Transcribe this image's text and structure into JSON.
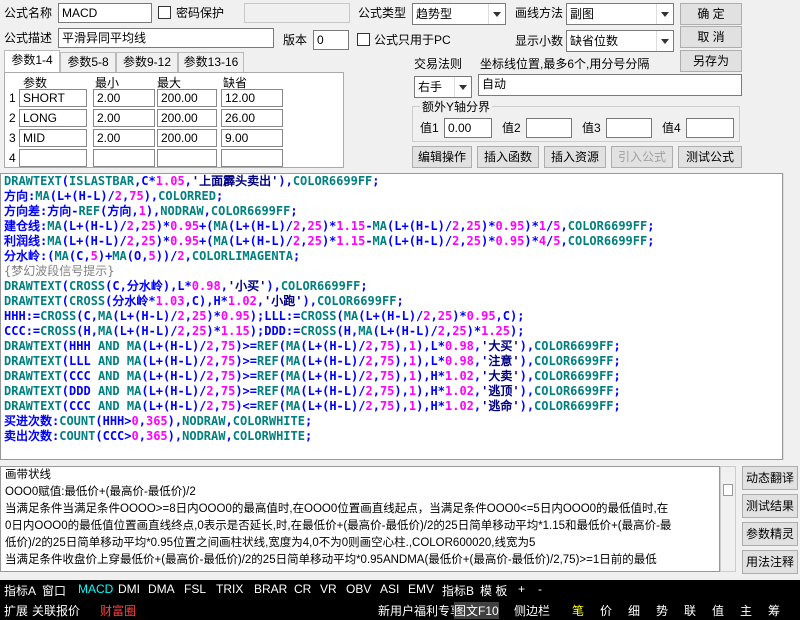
{
  "form": {
    "name_label": "公式名称",
    "name_value": "MACD",
    "pwd_label": "密码保护",
    "type_label": "公式类型",
    "type_value": "趋势型",
    "draw_label": "画线方法",
    "draw_value": "副图",
    "ok": "确  定",
    "cancel": "取  消",
    "saveas": "另存为",
    "desc_label": "公式描述",
    "desc_value": "平滑异同平均线",
    "ver_label": "版本",
    "ver_value": "0",
    "pc_label": "公式只用于PC",
    "dec_label": "显示小数",
    "dec_value": "缺省位数"
  },
  "tabs": [
    "参数1-4",
    "参数5-8",
    "参数9-12",
    "参数13-16"
  ],
  "params": {
    "headers": [
      "参数",
      "最小",
      "最大",
      "缺省"
    ],
    "rows": [
      {
        "n": "1",
        "name": "SHORT",
        "min": "2.00",
        "max": "200.00",
        "def": "12.00"
      },
      {
        "n": "2",
        "name": "LONG",
        "min": "2.00",
        "max": "200.00",
        "def": "26.00"
      },
      {
        "n": "3",
        "name": "MID",
        "min": "2.00",
        "max": "200.00",
        "def": "9.00"
      },
      {
        "n": "4",
        "name": "",
        "min": "",
        "max": "",
        "def": ""
      }
    ]
  },
  "trade": {
    "label": "交易法则",
    "value": "右手",
    "coord_label": "坐标线位置,最多6个,用分号分隔",
    "coord_value": "自动"
  },
  "yaxis": {
    "title": "额外Y轴分界",
    "v1_label": "值1",
    "v1_value": "0.00",
    "v2_label": "值2",
    "v3_label": "值3",
    "v4_label": "值4"
  },
  "actions": {
    "edit": "编辑操作",
    "insfunc": "插入函数",
    "insres": "插入资源",
    "import": "引入公式",
    "test": "测试公式"
  },
  "code": [
    "DRAWTEXT(ISLASTBAR,C*1.05,'上面霹头卖出'),COLOR6699FF;",
    "方向:MA(L+(H-L)/2,75),COLORRED;",
    "方向差:方向-REF(方向,1),NODRAW,COLOR6699FF;",
    "建仓线:MA(L+(H-L)/2,25)*0.95+(MA(L+(H-L)/2,25)*1.15-MA(L+(H-L)/2,25)*0.95)*1/5,COLOR6699FF;",
    "利润线:MA(L+(H-L)/2,25)*0.95+(MA(L+(H-L)/2,25)*1.15-MA(L+(H-L)/2,25)*0.95)*4/5,COLOR6699FF;",
    "分水岭:(MA(C,5)+MA(O,5))/2,COLORLIMAGENTA;",
    "{梦幻波段信号提示}",
    "DRAWTEXT(CROSS(C,分水岭),L*0.98,'小买'),COLOR6699FF;",
    "DRAWTEXT(CROSS(分水岭*1.03,C),H*1.02,'小跑'),COLOR6699FF;",
    "HHH:=CROSS(C,MA(L+(H-L)/2,25)*0.95);LLL:=CROSS(MA(L+(H-L)/2,25)*0.95,C);",
    "CCC:=CROSS(H,MA(L+(H-L)/2,25)*1.15);DDD:=CROSS(H,MA(L+(H-L)/2,25)*1.25);",
    "DRAWTEXT(HHH AND MA(L+(H-L)/2,75)>=REF(MA(L+(H-L)/2,75),1),L*0.98,'大买'),COLOR6699FF;",
    "DRAWTEXT(LLL AND MA(L+(H-L)/2,75)>=REF(MA(L+(H-L)/2,75),1),L*0.98,'注意'),COLOR6699FF;",
    "DRAWTEXT(CCC AND MA(L+(H-L)/2,75)>=REF(MA(L+(H-L)/2,75),1),H*1.02,'大卖'),COLOR6699FF;",
    "DRAWTEXT(DDD AND MA(L+(H-L)/2,75)>=REF(MA(L+(H-L)/2,75),1),H*1.02,'逃顶'),COLOR6699FF;",
    "DRAWTEXT(CCC AND MA(L+(H-L)/2,75)<=REF(MA(L+(H-L)/2,75),1),H*1.02,'逃命'),COLOR6699FF;",
    "买进次数:COUNT(HHH>0,365),NODRAW,COLORWHITE;",
    "卖出次数:COUNT(CCC>0,365),NODRAW,COLORWHITE;"
  ],
  "help": [
    "画带状线",
    "OOO0赋值:最低价+(最高价-最低价)/2",
    "当满足条件当满足条件OOOO>=8日内OOO0的最高值时,在OOO0位置画直线起点，当满足条件OOO0<=5日内OOO0的最低值时,在",
    "0日内OOO0的最低值位置画直线终点,0表示是否延长,时,在最低价+(最高价-最低价)/2的25日简单移动平均*1.15和最低价+(最高价-最",
    "低价)/2的25日简单移动平均*0.95位置之间画柱状线,宽度为4,0不为0则画空心柱.,COLOR600020,线宽为5",
    "当满足条件收盘价上穿最低价+(最高价-最低价)/2的25日简单移动平均*0.95ANDMA(最低价+(最高价-最低价)/2,75)>=1日前的最低"
  ],
  "side": {
    "trans": "动态翻译",
    "result": "测试结果",
    "wizard": "参数精灵",
    "usage": "用法注释"
  },
  "bar1": [
    "指标A",
    "窗口",
    "MACD",
    "DMI",
    "DMA",
    "FSL",
    "TRIX",
    "BRAR",
    "CR",
    "VR",
    "OBV",
    "ASI",
    "EMV",
    "指标B",
    "模 板",
    "+",
    "-"
  ],
  "bar2": [
    "扩展",
    "关联报价",
    "财富圈",
    "新用户福利专享",
    "图文F10",
    "侧边栏",
    "笔",
    "价",
    "细",
    "势",
    "联",
    "值",
    "主",
    "筹"
  ],
  "colors": {
    "code": "#0000ff",
    "fn": "#008080",
    "num": "#ff00ff",
    "plain": "#000080"
  }
}
